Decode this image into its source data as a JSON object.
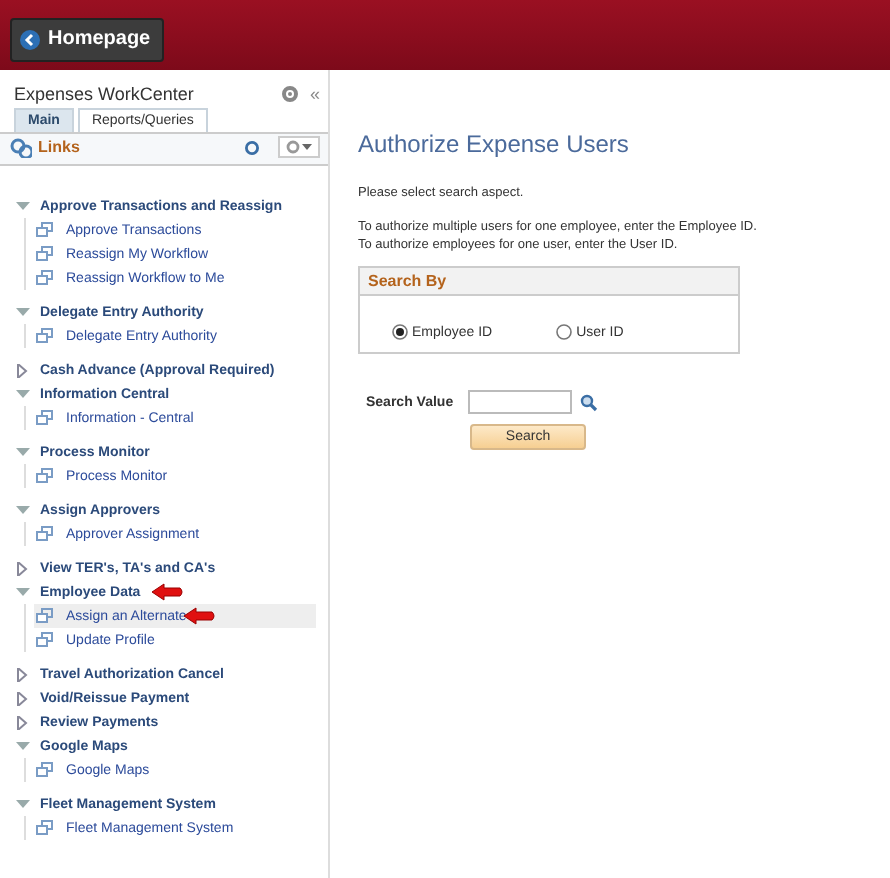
{
  "header": {
    "home_button": "Homepage"
  },
  "sidebar": {
    "title": "Expenses WorkCenter",
    "collapse": "«",
    "tabs": [
      {
        "label": "Main",
        "selected": true
      },
      {
        "label": "Reports/Queries",
        "selected": false
      }
    ],
    "links_title": "Links",
    "groups": [
      {
        "label": "Approve Transactions and Reassign",
        "expanded": true,
        "annotated": false,
        "children": [
          {
            "label": "Approve Transactions",
            "selected": false,
            "annotated": false
          },
          {
            "label": "Reassign My Workflow",
            "selected": false,
            "annotated": false
          },
          {
            "label": "Reassign Workflow to Me",
            "selected": false,
            "annotated": false
          }
        ]
      },
      {
        "label": "Delegate Entry Authority",
        "expanded": true,
        "annotated": false,
        "children": [
          {
            "label": "Delegate Entry Authority",
            "selected": false,
            "annotated": false
          }
        ]
      },
      {
        "label": "Cash Advance (Approval Required)",
        "expanded": false,
        "annotated": false
      },
      {
        "label": "Information Central",
        "expanded": true,
        "annotated": false,
        "children": [
          {
            "label": "Information - Central",
            "selected": false,
            "annotated": false
          }
        ]
      },
      {
        "label": "Process Monitor",
        "expanded": true,
        "annotated": false,
        "children": [
          {
            "label": "Process Monitor",
            "selected": false,
            "annotated": false
          }
        ]
      },
      {
        "label": "Assign Approvers",
        "expanded": true,
        "annotated": false,
        "children": [
          {
            "label": "Approver Assignment",
            "selected": false,
            "annotated": false
          }
        ]
      },
      {
        "label": "View TER's, TA's and CA's",
        "expanded": false,
        "annotated": false
      },
      {
        "label": "Employee Data",
        "expanded": true,
        "annotated": true,
        "children": [
          {
            "label": "Assign an Alternate",
            "selected": true,
            "annotated": true
          },
          {
            "label": "Update Profile",
            "selected": false,
            "annotated": false
          }
        ]
      },
      {
        "label": "Travel Authorization Cancel",
        "expanded": false,
        "annotated": false
      },
      {
        "label": "Void/Reissue Payment",
        "expanded": false,
        "annotated": false
      },
      {
        "label": "Review Payments",
        "expanded": false,
        "annotated": false
      },
      {
        "label": "Google Maps",
        "expanded": true,
        "annotated": false,
        "children": [
          {
            "label": "Google Maps",
            "selected": false,
            "annotated": false
          }
        ]
      },
      {
        "label": "Fleet Management System",
        "expanded": true,
        "annotated": false,
        "children": [
          {
            "label": "Fleet Management System",
            "selected": false,
            "annotated": false
          }
        ]
      }
    ]
  },
  "content": {
    "title": "Authorize Expense Users",
    "instructions": [
      "Please select search aspect.",
      "To authorize multiple users for one employee, enter the Employee ID.",
      "To authorize employees for one user, enter the User ID."
    ],
    "search_by": {
      "title": "Search By",
      "options": [
        {
          "label": "Employee ID",
          "selected": true
        },
        {
          "label": "User ID",
          "selected": false
        }
      ]
    },
    "search_value_label": "Search Value",
    "search_button": "Search"
  }
}
